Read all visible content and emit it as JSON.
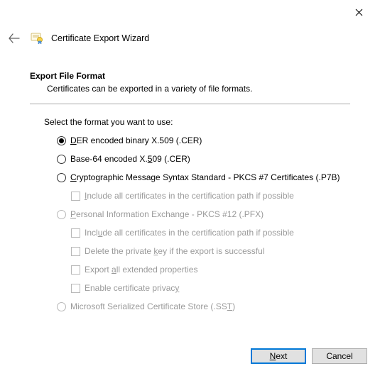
{
  "window": {
    "title": "Certificate Export Wizard"
  },
  "page": {
    "heading": "Export File Format",
    "sub": "Certificates can be exported in a variety of file formats.",
    "instruction": "Select the format you want to use:"
  },
  "options": {
    "der": {
      "pre": "",
      "u": "D",
      "post": "ER encoded binary X.509 (.CER)"
    },
    "b64": {
      "pre": "Base-64 encoded X.",
      "u": "5",
      "post": "09 (.CER)"
    },
    "p7b": {
      "pre": "",
      "u": "C",
      "post": "ryptographic Message Syntax Standard - PKCS #7 Certificates (.P7B)"
    },
    "p7b_inc": {
      "pre": "",
      "u": "I",
      "post": "nclude all certificates in the certification path if possible"
    },
    "pfx": {
      "pre": "",
      "u": "P",
      "post": "ersonal Information Exchange - PKCS #12 (.PFX)"
    },
    "pfx_inc": {
      "pre": "Incl",
      "u": "u",
      "post": "de all certificates in the certification path if possible"
    },
    "pfx_del": {
      "pre": "Delete the private ",
      "u": "k",
      "post": "ey if the export is successful"
    },
    "pfx_ext": {
      "pre": "Export ",
      "u": "a",
      "post": "ll extended properties"
    },
    "pfx_priv": {
      "pre": "Enable certificate privac",
      "u": "y",
      "post": ""
    },
    "sst": {
      "pre": "Microsoft Serialized Certificate Store (.SS",
      "u": "T",
      "post": ")"
    }
  },
  "buttons": {
    "next": {
      "u": "N",
      "post": "ext"
    },
    "cancel": "Cancel"
  }
}
